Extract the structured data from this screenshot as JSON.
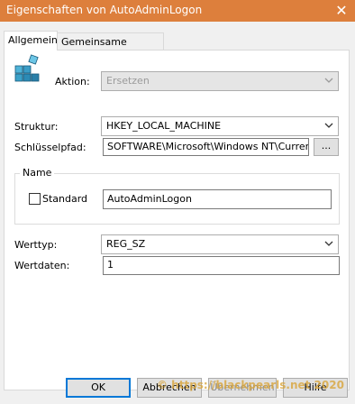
{
  "window": {
    "title": "Eigenschaften von AutoAdminLogon",
    "close_glyph": "✕"
  },
  "tabs": [
    {
      "label": "Allgemein"
    },
    {
      "label": "Gemeinsame Optionen"
    }
  ],
  "form": {
    "action_label": "Aktion:",
    "action_value": "Ersetzen",
    "hive_label": "Struktur:",
    "hive_value": "HKEY_LOCAL_MACHINE",
    "keypath_label": "Schlüsselpfad:",
    "keypath_value": "SOFTWARE\\Microsoft\\Windows NT\\CurrentVer",
    "browse_label": "...",
    "name_group_label": "Name",
    "default_label": "Standard",
    "name_value": "AutoAdminLogon",
    "valuetype_label": "Werttyp:",
    "valuetype_value": "REG_SZ",
    "valuedata_label": "Wertdaten:",
    "valuedata_value": "1"
  },
  "buttons": {
    "ok": "OK",
    "cancel": "Abbrechen",
    "apply": "Übernehmen",
    "help": "Hilfe"
  },
  "watermark": "© https://blackpearls.net 2020",
  "colors": {
    "titlebar": "#dd7f3c",
    "accent": "#0078d7"
  },
  "icons": {
    "registry": "registry-cubes-icon"
  }
}
